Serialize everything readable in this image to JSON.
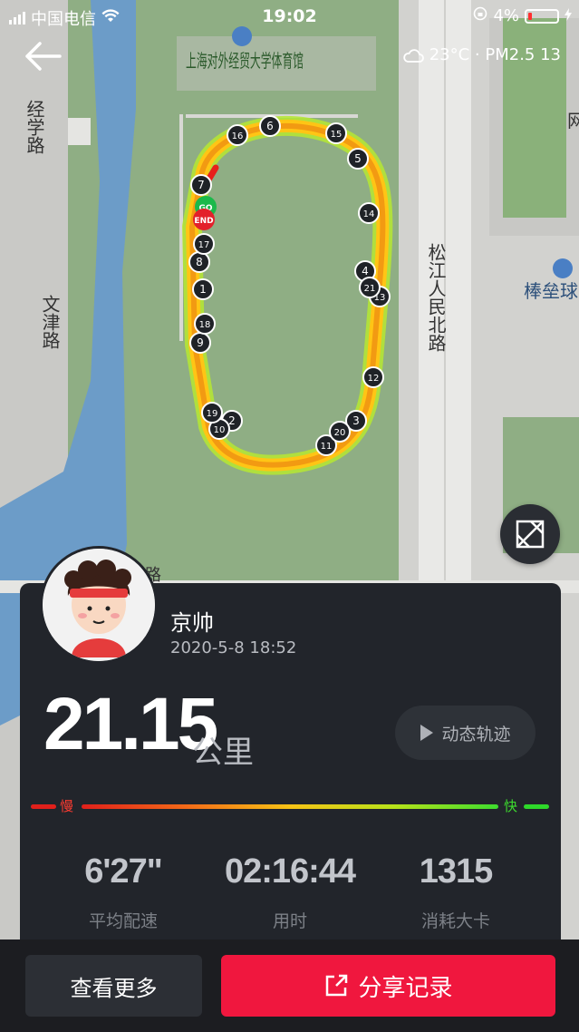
{
  "status_bar": {
    "carrier": "中国电信",
    "time": "19:02",
    "battery": "4%"
  },
  "weather": {
    "text": "23°C · PM2.5 13"
  },
  "map": {
    "labels": {
      "venue": "上海对外经贸大学体育馆",
      "road_jing": "经学路",
      "road_wenjin": "文津路",
      "road_songjiang": "松江人民北路",
      "baseball": "棒垒球",
      "corner": "网",
      "road_fragment": "路"
    },
    "start_marker": "GO",
    "end_marker": "END",
    "km_markers": [
      "1",
      "2",
      "3",
      "4",
      "5",
      "6",
      "7",
      "8",
      "9",
      "10",
      "11",
      "12",
      "13",
      "14",
      "15",
      "16",
      "17",
      "18",
      "19",
      "20",
      "21"
    ]
  },
  "runner": {
    "name": "京帅",
    "datetime": "2020-5-8 18:52"
  },
  "summary": {
    "distance": "21.15",
    "unit": "公里"
  },
  "replay_button": {
    "label": "动态轨迹"
  },
  "speed_legend": {
    "slow": "慢",
    "fast": "快"
  },
  "stats": [
    {
      "value": "6'27\"",
      "label": "平均配速"
    },
    {
      "value": "02:16:44",
      "label": "用时"
    },
    {
      "value": "1315",
      "label": "消耗大卡"
    }
  ],
  "actions": {
    "more": "查看更多",
    "share": "分享记录"
  },
  "colors": {
    "accent": "#f0173e",
    "card": "#22252b",
    "slow": "#e0201b",
    "fast": "#3ddc2e"
  }
}
